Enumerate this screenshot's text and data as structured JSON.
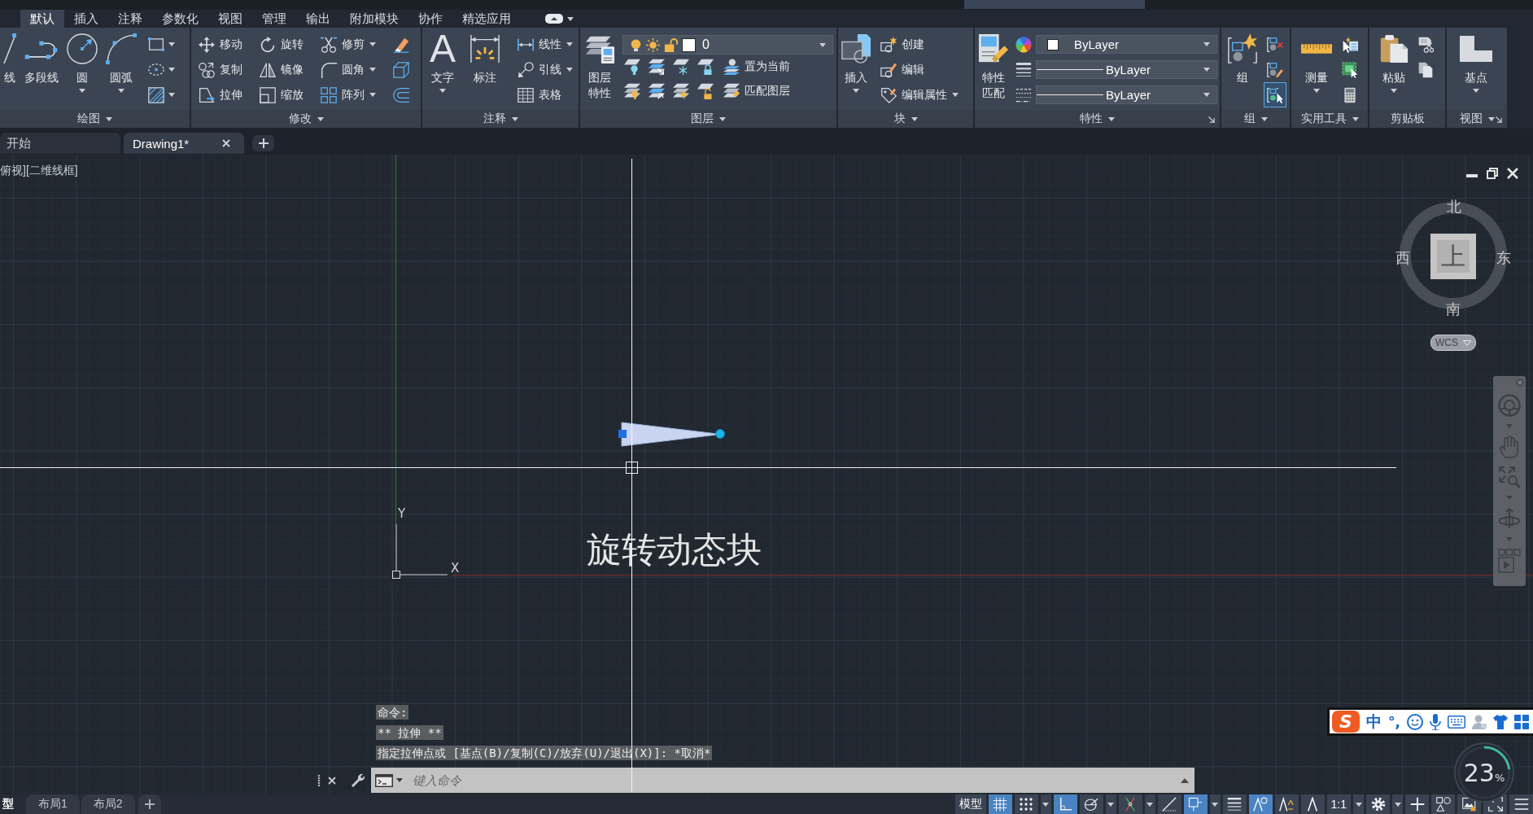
{
  "ribbon_tabs": [
    {
      "label": "默认",
      "selected": true
    },
    {
      "label": "插入",
      "selected": false
    },
    {
      "label": "注释",
      "selected": false
    },
    {
      "label": "参数化",
      "selected": false
    },
    {
      "label": "视图",
      "selected": false
    },
    {
      "label": "管理",
      "selected": false
    },
    {
      "label": "输出",
      "selected": false
    },
    {
      "label": "附加模块",
      "selected": false
    },
    {
      "label": "协作",
      "selected": false
    },
    {
      "label": "精选应用",
      "selected": false
    }
  ],
  "panels": [
    {
      "title": "绘图",
      "menu": true,
      "launcher": false,
      "items": [
        {
          "kind": "large",
          "label": "线",
          "dropdown": false
        },
        {
          "kind": "large",
          "label": "多段线",
          "dropdown": false
        },
        {
          "kind": "large",
          "label": "圆",
          "dropdown": true
        },
        {
          "kind": "large",
          "label": "圆弧",
          "dropdown": true
        },
        {
          "kind": "stack",
          "tools": [
            {
              "kind": "icon",
              "dropdown": true,
              "on": false
            },
            {
              "kind": "icon",
              "dropdown": true,
              "on": false
            },
            {
              "kind": "icon",
              "dropdown": true,
              "on": false
            }
          ]
        }
      ]
    },
    {
      "title": "修改",
      "menu": true,
      "launcher": false,
      "items": [
        {
          "kind": "stack",
          "tools": [
            {
              "kind": "small",
              "label": "移动",
              "dropdown": false,
              "on": false
            },
            {
              "kind": "small",
              "label": "复制",
              "dropdown": false,
              "on": false
            },
            {
              "kind": "small",
              "label": "拉伸",
              "dropdown": false,
              "on": false
            }
          ]
        },
        {
          "kind": "stack",
          "tools": [
            {
              "kind": "small",
              "label": "旋转",
              "dropdown": false,
              "on": false
            },
            {
              "kind": "small",
              "label": "镜像",
              "dropdown": false,
              "on": false
            },
            {
              "kind": "small",
              "label": "缩放",
              "dropdown": false,
              "on": false
            }
          ]
        },
        {
          "kind": "stack",
          "tools": [
            {
              "kind": "small",
              "label": "修剪",
              "dropdown": true,
              "on": false
            },
            {
              "kind": "small",
              "label": "圆角",
              "dropdown": true,
              "on": false
            },
            {
              "kind": "small",
              "label": "阵列",
              "dropdown": true,
              "on": false
            }
          ]
        },
        {
          "kind": "stack",
          "tools": [
            {
              "kind": "icon",
              "dropdown": false,
              "on": false
            },
            {
              "kind": "icon",
              "dropdown": false,
              "on": false
            },
            {
              "kind": "icon",
              "dropdown": false,
              "on": false
            }
          ]
        }
      ]
    },
    {
      "title": "注释",
      "menu": true,
      "launcher": false,
      "items": [
        {
          "kind": "large",
          "glyph": "A",
          "label": "文字",
          "dropdown": true
        },
        {
          "kind": "large",
          "label": "标注",
          "dropdown": false
        },
        {
          "kind": "stack",
          "tools": [
            {
              "kind": "small",
              "label": "线性",
              "dropdown": true,
              "on": false
            },
            {
              "kind": "small",
              "label": "引线",
              "dropdown": true,
              "on": false
            },
            {
              "kind": "small",
              "label": "表格",
              "dropdown": false,
              "on": false
            }
          ]
        }
      ]
    },
    {
      "title": "图层",
      "menu": true,
      "launcher": false,
      "items": [
        {
          "kind": "large",
          "label": "图层特性",
          "dropdown": false
        },
        {
          "kind": "layer_block",
          "layer": "0",
          "rows": [
            {
              "label": "置为当前"
            },
            {
              "label": "匹配图层"
            }
          ]
        }
      ]
    },
    {
      "title": "块",
      "menu": true,
      "launcher": false,
      "items": [
        {
          "kind": "large",
          "label": "插入",
          "dropdown": true
        },
        {
          "kind": "stack",
          "tools": [
            {
              "kind": "small",
              "label": "创建",
              "dropdown": false,
              "on": false
            },
            {
              "kind": "small",
              "label": "编辑",
              "dropdown": false,
              "on": false
            },
            {
              "kind": "small",
              "label": "编辑属性",
              "dropdown": true,
              "on": false
            }
          ]
        }
      ]
    },
    {
      "title": "特性",
      "menu": true,
      "launcher": true,
      "items": [
        {
          "kind": "large",
          "label": "特性匹配",
          "dropdown": false
        },
        {
          "kind": "props_block",
          "combos": [
            {
              "kind": "color",
              "value": "ByLayer"
            },
            {
              "kind": "line",
              "value": "ByLayer"
            },
            {
              "kind": "line",
              "value": "ByLayer"
            }
          ]
        }
      ]
    },
    {
      "title": "组",
      "menu": true,
      "launcher": false,
      "items": [
        {
          "kind": "large",
          "label": "组",
          "dropdown": false
        },
        {
          "kind": "stack",
          "tools": [
            {
              "kind": "icon",
              "dropdown": false,
              "on": false
            },
            {
              "kind": "icon",
              "dropdown": false,
              "on": false
            },
            {
              "kind": "icon",
              "dropdown": false,
              "on": true
            }
          ]
        }
      ]
    },
    {
      "title": "实用工具",
      "menu": true,
      "launcher": false,
      "items": [
        {
          "kind": "large",
          "label": "测量",
          "dropdown": true
        },
        {
          "kind": "stack",
          "tools": [
            {
              "kind": "icon",
              "dropdown": false,
              "on": false
            },
            {
              "kind": "icon",
              "dropdown": false,
              "on": false
            },
            {
              "kind": "icon",
              "dropdown": false,
              "on": false
            }
          ]
        }
      ]
    },
    {
      "title": "剪贴板",
      "menu": false,
      "launcher": false,
      "items": [
        {
          "kind": "large",
          "label": "粘贴",
          "dropdown": true
        },
        {
          "kind": "stack",
          "tools": [
            {
              "kind": "icon",
              "dropdown": false,
              "on": false
            },
            {
              "kind": "icon",
              "dropdown": false,
              "on": false
            }
          ]
        }
      ]
    },
    {
      "title": "视图",
      "menu": true,
      "launcher": true,
      "items": [
        {
          "kind": "large",
          "label": "基点",
          "dropdown": true
        }
      ]
    }
  ],
  "doc_tabs": [
    {
      "label": "开始",
      "selected": false,
      "closable": false
    },
    {
      "label": "Drawing1*",
      "selected": true,
      "closable": true
    }
  ],
  "viewport": {
    "label": "俯视][二维线框]",
    "drawing_text": "旋转动态块",
    "ucs": {
      "y": "Y",
      "x": "X"
    },
    "viewcube": {
      "north": "北",
      "west": "西",
      "face": "上",
      "east": "东",
      "south": "南"
    },
    "coordinate_system": "WCS"
  },
  "command_history": [
    "命令:",
    "** 拉伸 **",
    "指定拉伸点或 [基点(B)/复制(C)/放弃(U)/退出(X)]: *取消*"
  ],
  "command_line": {
    "placeholder": "键入命令"
  },
  "ime_toolbar": {
    "logo": "S",
    "mode": "中",
    "punctuation": "°,"
  },
  "recorder": {
    "value": "23",
    "unit": "%",
    "level": 0.23
  },
  "layout_tabs": [
    {
      "label": "型",
      "selected": true
    },
    {
      "label": "布局1",
      "selected": false
    },
    {
      "label": "布局2",
      "selected": false
    }
  ],
  "status_bar": [
    {
      "kind": "text",
      "label": "模型",
      "on": false,
      "dropdown": false
    },
    {
      "kind": "toggle",
      "on": true,
      "dropdown": false
    },
    {
      "kind": "toggle",
      "on": false,
      "dropdown": true
    },
    {
      "kind": "toggle",
      "on": true,
      "dropdown": false
    },
    {
      "kind": "toggle",
      "on": false,
      "dropdown": true
    },
    {
      "kind": "toggle",
      "on": false,
      "dropdown": true
    },
    {
      "kind": "toggle",
      "on": false,
      "dropdown": false
    },
    {
      "kind": "toggle",
      "on": true,
      "dropdown": true
    },
    {
      "kind": "toggle",
      "on": false,
      "dropdown": false
    },
    {
      "kind": "toggle",
      "on": true,
      "dropdown": false
    },
    {
      "kind": "toggle",
      "on": false,
      "dropdown": false
    },
    {
      "kind": "toggle",
      "on": false,
      "dropdown": false
    },
    {
      "kind": "text",
      "label": "1:1",
      "on": false,
      "dropdown": true
    },
    {
      "kind": "toggle",
      "on": false,
      "dropdown": true
    },
    {
      "kind": "toggle",
      "on": false,
      "dropdown": false
    },
    {
      "kind": "toggle",
      "on": false,
      "dropdown": false
    },
    {
      "kind": "toggle",
      "on": false,
      "dropdown": false
    },
    {
      "kind": "toggle",
      "on": false,
      "dropdown": false
    },
    {
      "kind": "toggle",
      "on": false,
      "dropdown": false
    }
  ]
}
